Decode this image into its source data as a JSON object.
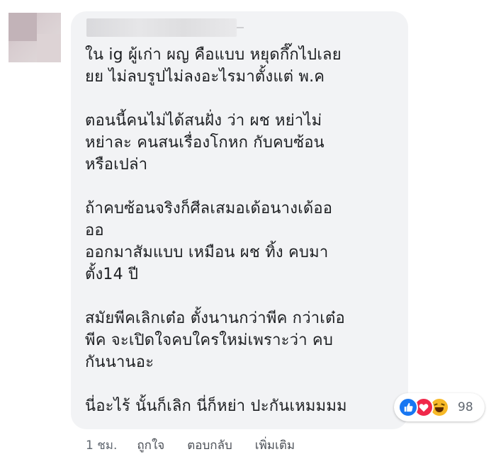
{
  "comment": {
    "author_name_redacted": true,
    "lines": [
      "ใน ig ผู้เก่า ผญ คือแบบ หยุดกึ๊กไปเลย",
      "ยย ไม่ลบรูปไม่ลงอะไรมาตั้งแต่ พ.ค",
      "",
      "ตอนนี้คนไม่ได้สนฝั่ง ว่า ผช หย่าไม่",
      "หย่าละ คนสนเรื่องโกหก กับคบซ้อน",
      "หรือเปล่า",
      "",
      "ถ้าคบซ้อนจริงก็ศีลเสมอเด้อนางเด้ออ",
      "ออ",
      "ออกมาสัมแบบ เหมือน ผช ทิ้ง คบมา",
      "ตั้ง14 ปี",
      "",
      "สมัยพีคเลิกเต๋อ ตั้งนานกว่าพีค กว่าเต๋อ",
      "พีค จะเปิดใจคบใครใหม่เพราะว่า คบ",
      "กันนานอะ",
      "",
      "นี่อะไร้ นั้นก็เลิก นี่ก็หย่า ปะกันเหมมมม"
    ]
  },
  "reactions": {
    "icons": [
      "like-icon",
      "love-icon",
      "haha-icon"
    ],
    "count": "98",
    "colors": {
      "like": "#1877f2",
      "love": "#f0284a",
      "haha": "#f7b928"
    }
  },
  "actions": {
    "time": "1 ชม.",
    "like": "ถูกใจ",
    "reply": "ตอบกลับ",
    "more": "เพิ่มเติม"
  }
}
